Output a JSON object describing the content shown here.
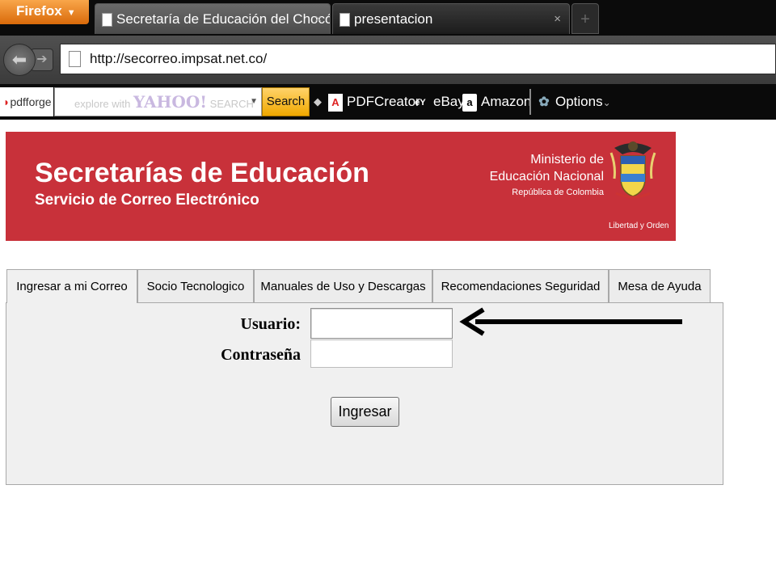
{
  "browser": {
    "menu_label": "Firefox",
    "tabs": [
      {
        "title": "Secretaría de Educación del Chocó",
        "close": "×"
      },
      {
        "title": "presentacion",
        "close": "×"
      }
    ],
    "new_tab_symbol": "+",
    "url": "http://secorreo.impsat.net.co/"
  },
  "toolbar": {
    "pdfforge_label": "pdfforge",
    "search_placeholder_prefix": "explore with",
    "search_placeholder_brand": "YAHOO!",
    "search_placeholder_suffix": "SEARCH",
    "search_button": "Search",
    "items": [
      {
        "label": "PDFCreator",
        "icon": "pdf-icon"
      },
      {
        "label": "eBay",
        "icon": "ebay-icon"
      },
      {
        "label": "Amazon",
        "icon": "amazon-icon"
      },
      {
        "label": "Options",
        "icon": "gear-icon"
      }
    ],
    "options_caret": "⌄"
  },
  "banner": {
    "title": "Secretarías de Educación",
    "subtitle": "Servicio de Correo Electrónico",
    "ministry_line1": "Ministerio de",
    "ministry_line2": "Educación Nacional",
    "ministry_line3": "República de Colombia",
    "motto": "Libertad y Orden",
    "color": "#c8313a"
  },
  "page_tabs": [
    {
      "label": "Ingresar a mi Correo",
      "active": true
    },
    {
      "label": "Socio Tecnologico",
      "active": false
    },
    {
      "label": "Manuales de Uso y Descargas",
      "active": false
    },
    {
      "label": "Recomendaciones Seguridad",
      "active": false
    },
    {
      "label": "Mesa de Ayuda",
      "active": false
    }
  ],
  "login": {
    "user_label": "Usuario:",
    "password_label": "Contraseña",
    "user_value": "",
    "password_value": "",
    "submit_label": "Ingresar"
  },
  "annotation": {
    "arrow_color": "#000000"
  }
}
